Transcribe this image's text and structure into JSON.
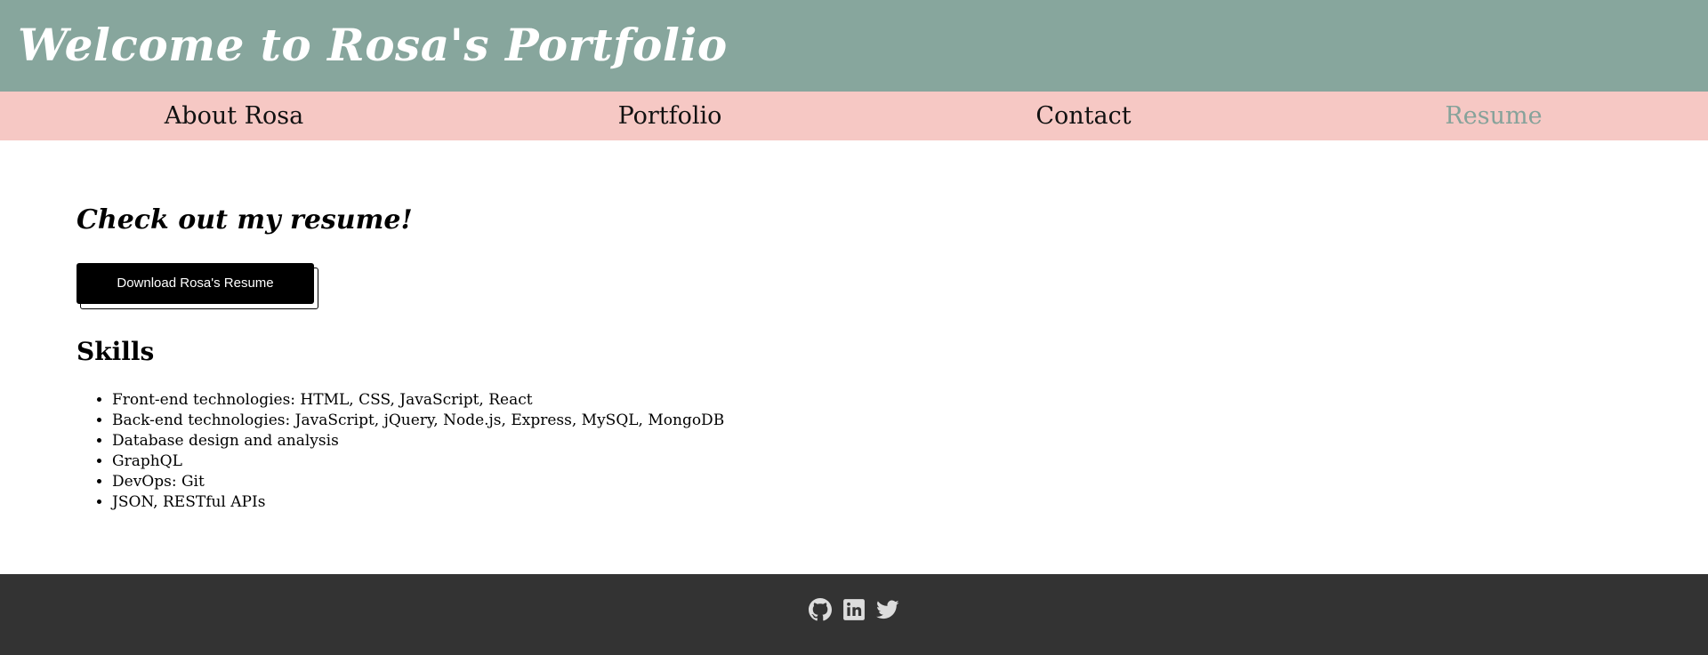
{
  "header": {
    "title": "Welcome to Rosa's Portfolio",
    "background_color": "#87a69d"
  },
  "nav": {
    "background_color": "#f6c8c4",
    "active_color": "#86a29a",
    "items": [
      {
        "label": "About Rosa",
        "active": false
      },
      {
        "label": "Portfolio",
        "active": false
      },
      {
        "label": "Contact",
        "active": false
      },
      {
        "label": "Resume",
        "active": true
      }
    ]
  },
  "main": {
    "heading": "Check out my resume!",
    "download_button_label": "Download Rosa's Resume",
    "skills_heading": "Skills",
    "skills": [
      "Front-end technologies: HTML, CSS, JavaScript, React",
      "Back-end technologies: JavaScript, jQuery, Node.js, Express, MySQL, MongoDB",
      "Database design and analysis",
      "GraphQL",
      "DevOps: Git",
      "JSON, RESTful APIs"
    ]
  },
  "footer": {
    "background_color": "#333333",
    "icon_color": "#dddddd",
    "social_icons": [
      "github-icon",
      "linkedin-icon",
      "twitter-icon"
    ]
  }
}
